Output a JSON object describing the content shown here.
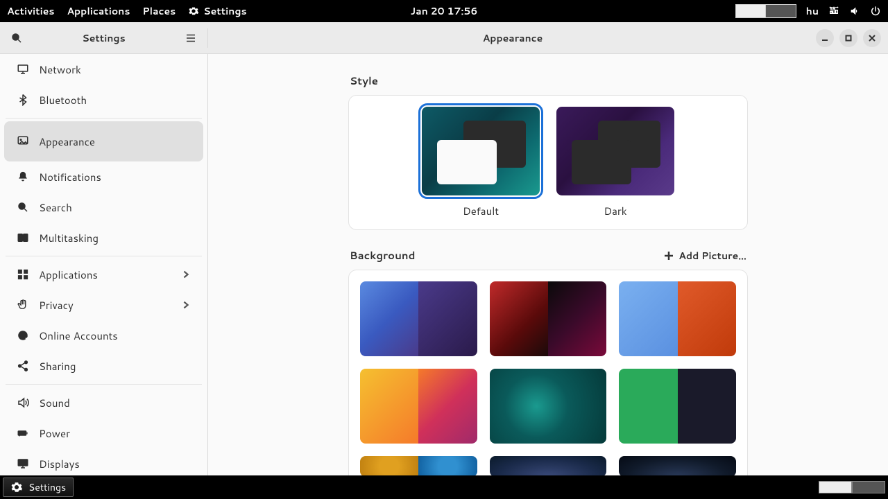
{
  "topbar": {
    "activities": "Activities",
    "applications": "Applications",
    "places": "Places",
    "app_label": "Settings",
    "clock": "Jan 20  17:56",
    "keyboard_layout": "hu"
  },
  "header": {
    "sidebar_title": "Settings",
    "main_title": "Appearance"
  },
  "sidebar": {
    "items": [
      {
        "label": "Network",
        "icon": "monitor"
      },
      {
        "label": "Bluetooth",
        "icon": "bluetooth"
      },
      {
        "label": "Appearance",
        "icon": "brush",
        "selected": true,
        "wide": true
      },
      {
        "label": "Notifications",
        "icon": "bell"
      },
      {
        "label": "Search",
        "icon": "search"
      },
      {
        "label": "Multitasking",
        "icon": "multi"
      },
      {
        "label": "Applications",
        "icon": "grid",
        "chevron": true
      },
      {
        "label": "Privacy",
        "icon": "hand",
        "chevron": true
      },
      {
        "label": "Online Accounts",
        "icon": "at"
      },
      {
        "label": "Sharing",
        "icon": "share"
      },
      {
        "label": "Sound",
        "icon": "sound"
      },
      {
        "label": "Power",
        "icon": "power"
      },
      {
        "label": "Displays",
        "icon": "display"
      }
    ]
  },
  "appearance": {
    "style_heading": "Style",
    "style_default": "Default",
    "style_dark": "Dark",
    "background_heading": "Background",
    "add_picture": "Add Picture…"
  },
  "taskbar": {
    "app": "Settings"
  }
}
